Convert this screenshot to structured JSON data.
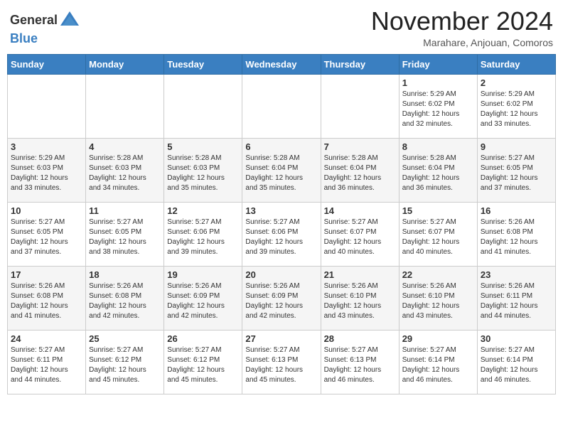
{
  "header": {
    "logo_line1": "General",
    "logo_line2": "Blue",
    "month": "November 2024",
    "location": "Marahare, Anjouan, Comoros"
  },
  "days_of_week": [
    "Sunday",
    "Monday",
    "Tuesday",
    "Wednesday",
    "Thursday",
    "Friday",
    "Saturday"
  ],
  "weeks": [
    [
      {
        "day": "",
        "info": ""
      },
      {
        "day": "",
        "info": ""
      },
      {
        "day": "",
        "info": ""
      },
      {
        "day": "",
        "info": ""
      },
      {
        "day": "",
        "info": ""
      },
      {
        "day": "1",
        "info": "Sunrise: 5:29 AM\nSunset: 6:02 PM\nDaylight: 12 hours\nand 32 minutes."
      },
      {
        "day": "2",
        "info": "Sunrise: 5:29 AM\nSunset: 6:02 PM\nDaylight: 12 hours\nand 33 minutes."
      }
    ],
    [
      {
        "day": "3",
        "info": "Sunrise: 5:29 AM\nSunset: 6:03 PM\nDaylight: 12 hours\nand 33 minutes."
      },
      {
        "day": "4",
        "info": "Sunrise: 5:28 AM\nSunset: 6:03 PM\nDaylight: 12 hours\nand 34 minutes."
      },
      {
        "day": "5",
        "info": "Sunrise: 5:28 AM\nSunset: 6:03 PM\nDaylight: 12 hours\nand 35 minutes."
      },
      {
        "day": "6",
        "info": "Sunrise: 5:28 AM\nSunset: 6:04 PM\nDaylight: 12 hours\nand 35 minutes."
      },
      {
        "day": "7",
        "info": "Sunrise: 5:28 AM\nSunset: 6:04 PM\nDaylight: 12 hours\nand 36 minutes."
      },
      {
        "day": "8",
        "info": "Sunrise: 5:28 AM\nSunset: 6:04 PM\nDaylight: 12 hours\nand 36 minutes."
      },
      {
        "day": "9",
        "info": "Sunrise: 5:27 AM\nSunset: 6:05 PM\nDaylight: 12 hours\nand 37 minutes."
      }
    ],
    [
      {
        "day": "10",
        "info": "Sunrise: 5:27 AM\nSunset: 6:05 PM\nDaylight: 12 hours\nand 37 minutes."
      },
      {
        "day": "11",
        "info": "Sunrise: 5:27 AM\nSunset: 6:05 PM\nDaylight: 12 hours\nand 38 minutes."
      },
      {
        "day": "12",
        "info": "Sunrise: 5:27 AM\nSunset: 6:06 PM\nDaylight: 12 hours\nand 39 minutes."
      },
      {
        "day": "13",
        "info": "Sunrise: 5:27 AM\nSunset: 6:06 PM\nDaylight: 12 hours\nand 39 minutes."
      },
      {
        "day": "14",
        "info": "Sunrise: 5:27 AM\nSunset: 6:07 PM\nDaylight: 12 hours\nand 40 minutes."
      },
      {
        "day": "15",
        "info": "Sunrise: 5:27 AM\nSunset: 6:07 PM\nDaylight: 12 hours\nand 40 minutes."
      },
      {
        "day": "16",
        "info": "Sunrise: 5:26 AM\nSunset: 6:08 PM\nDaylight: 12 hours\nand 41 minutes."
      }
    ],
    [
      {
        "day": "17",
        "info": "Sunrise: 5:26 AM\nSunset: 6:08 PM\nDaylight: 12 hours\nand 41 minutes."
      },
      {
        "day": "18",
        "info": "Sunrise: 5:26 AM\nSunset: 6:08 PM\nDaylight: 12 hours\nand 42 minutes."
      },
      {
        "day": "19",
        "info": "Sunrise: 5:26 AM\nSunset: 6:09 PM\nDaylight: 12 hours\nand 42 minutes."
      },
      {
        "day": "20",
        "info": "Sunrise: 5:26 AM\nSunset: 6:09 PM\nDaylight: 12 hours\nand 42 minutes."
      },
      {
        "day": "21",
        "info": "Sunrise: 5:26 AM\nSunset: 6:10 PM\nDaylight: 12 hours\nand 43 minutes."
      },
      {
        "day": "22",
        "info": "Sunrise: 5:26 AM\nSunset: 6:10 PM\nDaylight: 12 hours\nand 43 minutes."
      },
      {
        "day": "23",
        "info": "Sunrise: 5:26 AM\nSunset: 6:11 PM\nDaylight: 12 hours\nand 44 minutes."
      }
    ],
    [
      {
        "day": "24",
        "info": "Sunrise: 5:27 AM\nSunset: 6:11 PM\nDaylight: 12 hours\nand 44 minutes."
      },
      {
        "day": "25",
        "info": "Sunrise: 5:27 AM\nSunset: 6:12 PM\nDaylight: 12 hours\nand 45 minutes."
      },
      {
        "day": "26",
        "info": "Sunrise: 5:27 AM\nSunset: 6:12 PM\nDaylight: 12 hours\nand 45 minutes."
      },
      {
        "day": "27",
        "info": "Sunrise: 5:27 AM\nSunset: 6:13 PM\nDaylight: 12 hours\nand 45 minutes."
      },
      {
        "day": "28",
        "info": "Sunrise: 5:27 AM\nSunset: 6:13 PM\nDaylight: 12 hours\nand 46 minutes."
      },
      {
        "day": "29",
        "info": "Sunrise: 5:27 AM\nSunset: 6:14 PM\nDaylight: 12 hours\nand 46 minutes."
      },
      {
        "day": "30",
        "info": "Sunrise: 5:27 AM\nSunset: 6:14 PM\nDaylight: 12 hours\nand 46 minutes."
      }
    ]
  ]
}
